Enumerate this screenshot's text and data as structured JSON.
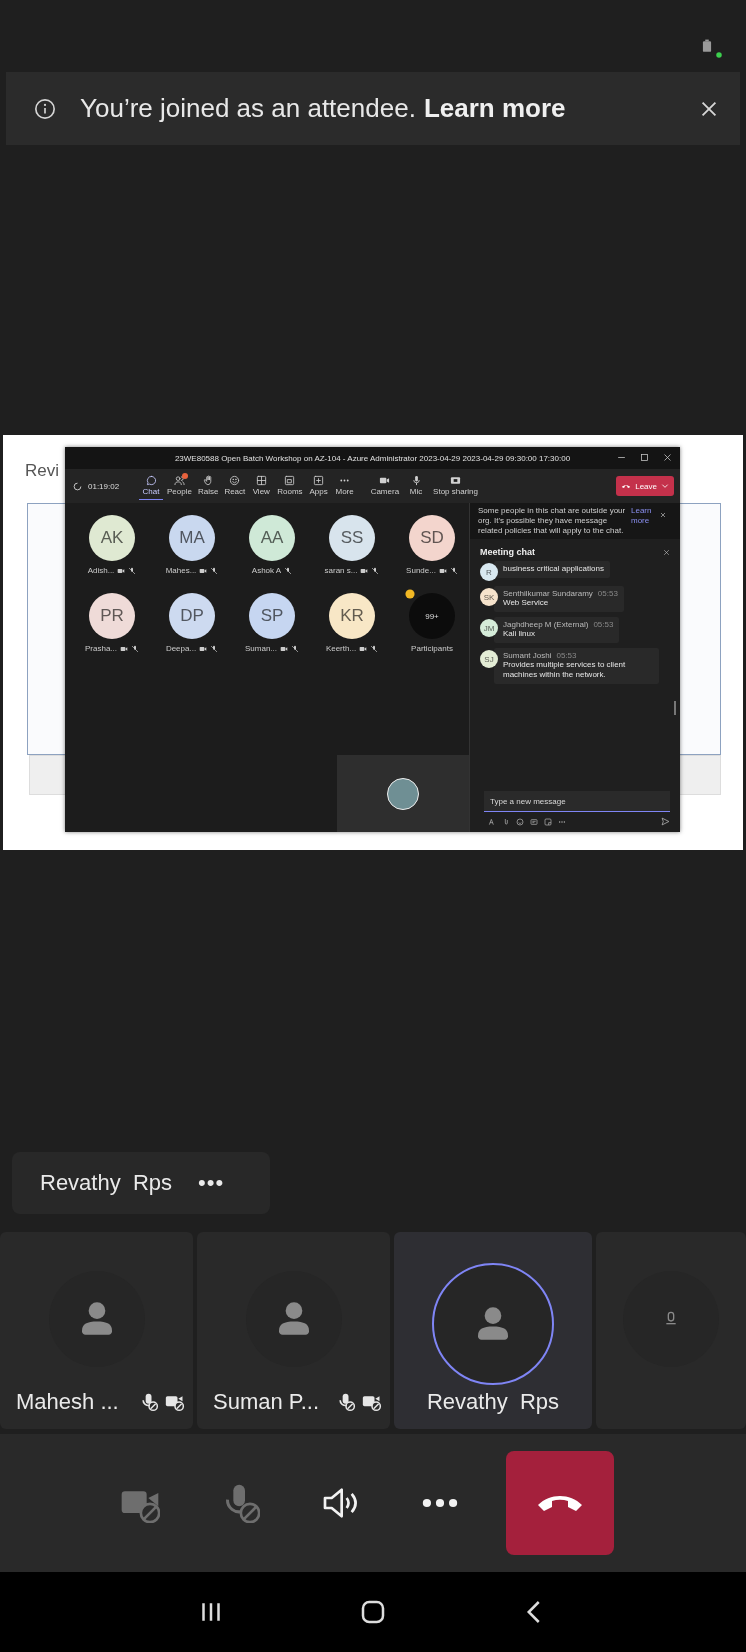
{
  "banner": {
    "message": "You’re joined as an attendee.",
    "link": "Learn more"
  },
  "shared_screen": {
    "slide_heading": "Revi",
    "window": {
      "title": "23WE80588 Open Batch Workshop on AZ-104 - Azure Administrator 2023-04-29 2023-04-29 09:30:00 17:30:00",
      "timer": "01:19:02",
      "toolbar": [
        {
          "kind": "chat",
          "label": "Chat",
          "selected": true
        },
        {
          "kind": "people",
          "label": "People",
          "selected": false
        },
        {
          "kind": "raise",
          "label": "Raise",
          "selected": false
        },
        {
          "kind": "react",
          "label": "React",
          "selected": false
        },
        {
          "kind": "view",
          "label": "View",
          "selected": false
        },
        {
          "kind": "rooms",
          "label": "Rooms",
          "selected": false
        },
        {
          "kind": "apps",
          "label": "Apps",
          "selected": false
        },
        {
          "kind": "more",
          "label": "More",
          "selected": false
        }
      ],
      "media": [
        {
          "kind": "camera",
          "label": "Camera"
        },
        {
          "kind": "mic",
          "label": "Mic"
        },
        {
          "kind": "share",
          "label": "Stop sharing"
        }
      ],
      "leave": "Leave",
      "participants": [
        {
          "initials": "AK",
          "name": "Adish...",
          "color": "#dfe9d2",
          "video_off": true
        },
        {
          "initials": "MA",
          "name": "Mahes...",
          "color": "#c9d8ef",
          "video_off": true
        },
        {
          "initials": "AA",
          "name": "Ashok A",
          "color": "#cfe9d7",
          "video_off": false
        },
        {
          "initials": "SS",
          "name": "saran s...",
          "color": "#d8e4ed",
          "video_off": true
        },
        {
          "initials": "SD",
          "name": "Sunde...",
          "color": "#f3d5cd",
          "video_off": true
        },
        {
          "initials": "PR",
          "name": "Prasha...",
          "color": "#efdbd8",
          "video_off": true
        },
        {
          "initials": "DP",
          "name": "Deepa...",
          "color": "#cddaf0",
          "video_off": true
        },
        {
          "initials": "SP",
          "name": "Suman...",
          "color": "#c6d6f1",
          "video_off": true
        },
        {
          "initials": "KR",
          "name": "Keerth...",
          "color": "#f8e7c6",
          "video_off": true
        }
      ],
      "overflow": {
        "count": "99+",
        "label": "Participants"
      },
      "chat": {
        "notice": "Some people in this chat are outside your org. It's possible they have message related policies that will apply to the chat.",
        "notice_link": "Learn more",
        "title": "Meeting chat",
        "messages": [
          {
            "initials": "R",
            "text": "business critical applications",
            "color": "#d8e8f0"
          },
          {
            "initials": "SK",
            "sender": "Senthilkumar Sundaramy",
            "time": "05:53",
            "text": "Web Service",
            "color": "#f6e3cc"
          },
          {
            "initials": "JM",
            "sender": "Jaghdheep M (External)",
            "time": "05:53",
            "text": "Kali linux",
            "color": "#d5ecd9"
          },
          {
            "initials": "SJ",
            "sender": "Sumant Joshi",
            "time": "05:53",
            "text": "Provides multiple services to client machines within the network.",
            "color": "#e3ecd5"
          }
        ],
        "placeholder": "Type a new message"
      }
    }
  },
  "presenter_chip": {
    "name": "Revathy  Rps",
    "more": "•••"
  },
  "tiles": [
    {
      "name": "Mahesh ...",
      "muted": true,
      "video_off": true,
      "speaking": false
    },
    {
      "name": "Suman P...",
      "muted": true,
      "video_off": true,
      "speaking": false
    },
    {
      "name": "Revathy  Rps",
      "muted": false,
      "video_off": false,
      "speaking": true
    },
    {
      "speaking": false
    }
  ],
  "controls": [
    {
      "kind": "camera",
      "off": true
    },
    {
      "kind": "mic",
      "off": true
    },
    {
      "kind": "speaker",
      "off": false
    },
    {
      "kind": "more",
      "off": false
    },
    {
      "kind": "end-call",
      "off": false
    }
  ]
}
